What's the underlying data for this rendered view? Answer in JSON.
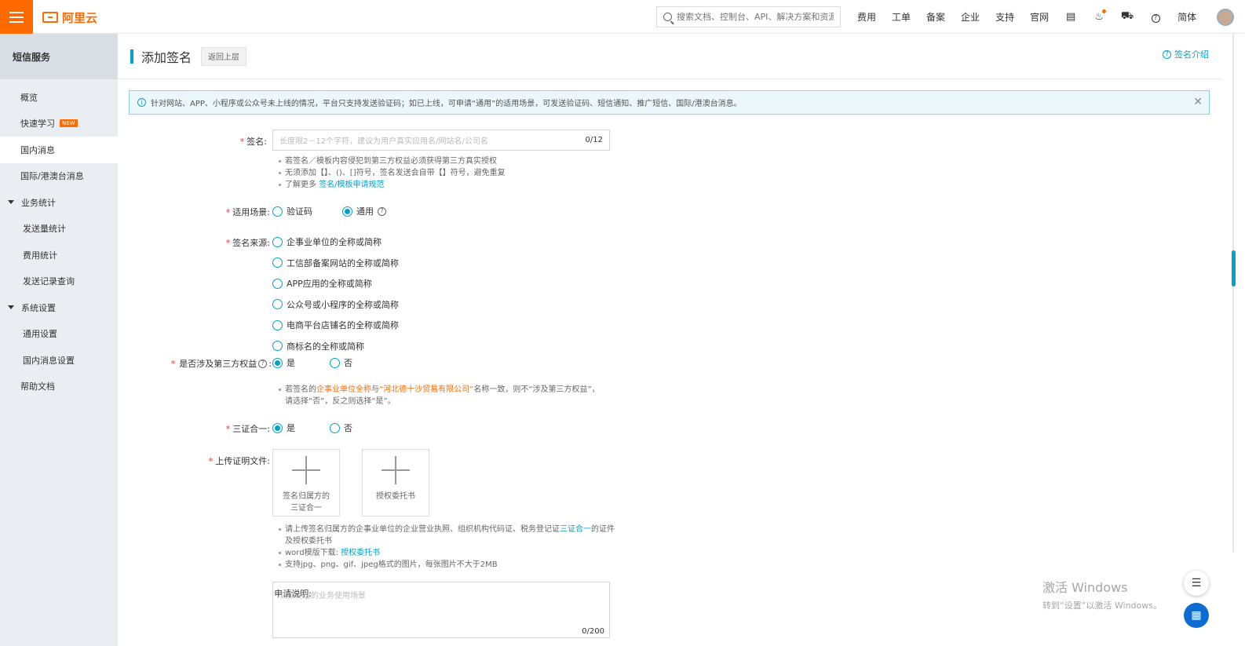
{
  "topbar": {
    "logo_text": "阿里云",
    "search_placeholder": "搜索文档、控制台、API、解决方案和资源",
    "nav": [
      "费用",
      "工单",
      "备案",
      "企业",
      "支持",
      "官网"
    ],
    "lang": "简体",
    "icons": [
      "terminal-icon",
      "bell-icon",
      "cart-icon",
      "help-icon"
    ]
  },
  "sidebar": {
    "title": "短信服务",
    "items": [
      {
        "label": "概览",
        "kind": "item"
      },
      {
        "label": "快速学习",
        "kind": "item",
        "badge": "NEW"
      },
      {
        "label": "国内消息",
        "kind": "item",
        "active": true
      },
      {
        "label": "国际/港澳台消息",
        "kind": "item"
      },
      {
        "label": "业务统计",
        "kind": "group"
      },
      {
        "label": "发送量统计",
        "kind": "sub"
      },
      {
        "label": "费用统计",
        "kind": "sub"
      },
      {
        "label": "发送记录查询",
        "kind": "sub"
      },
      {
        "label": "系统设置",
        "kind": "group"
      },
      {
        "label": "通用设置",
        "kind": "sub"
      },
      {
        "label": "国内消息设置",
        "kind": "sub"
      },
      {
        "label": "帮助文档",
        "kind": "item"
      }
    ]
  },
  "header": {
    "title": "添加签名",
    "back_label": "返回上层",
    "help_label": "签名介绍"
  },
  "notice": {
    "text": "针对网站、APP、小程序或公众号未上线的情况，平台只支持发送验证码；如已上线，可申请“通用”的适用场景，可发送验证码、短信通知、推广短信、国际/港澳台消息。"
  },
  "form": {
    "signature": {
      "label": "签名:",
      "placeholder": "长度限2－12个字符，建议为用户真实应用名/网站名/公司名",
      "counter": "0/12",
      "tips": [
        "若签名／模板内容侵犯到第三方权益必须获得第三方真实授权",
        "无须添加【】、()、[]符号，签名发送会自带【】符号，避免重复"
      ],
      "tip3_prefix": "了解更多",
      "tip3_link": "签名/模板申请规范"
    },
    "scenario": {
      "label": "适用场景:",
      "options": [
        "验证码",
        "通用"
      ],
      "selected": 1
    },
    "source": {
      "label": "签名来源:",
      "options": [
        "企事业单位的全称或简称",
        "工信部备案网站的全称或简称",
        "APP应用的全称或简称",
        "公众号或小程序的全称或简称",
        "电商平台店铺名的全称或简称",
        "商标名的全称或简称"
      ]
    },
    "third_party": {
      "label": "是否涉及第三方权益",
      "options": [
        "是",
        "否"
      ],
      "selected": 0,
      "tip_prefix": "若签名的",
      "tip_hl1": "企事业单位全称",
      "tip_mid": "与",
      "tip_hl2": "“河北德十沙贸易有限公司”",
      "tip_suffix": "名称一致，则不“涉及第三方权益”，请选择“否”，反之则选择“是”。"
    },
    "three_in_one": {
      "label": "三证合一:",
      "options": [
        "是",
        "否"
      ],
      "selected": 0
    },
    "upload": {
      "label": "上传证明文件:",
      "box1": "签名归属方的三证合一",
      "box2": "授权委托书",
      "tip1_prefix": "请上传签名归属方的企事业单位的企业营业执照、组织机构代码证、税务登记证",
      "tip1_link": "三证合一",
      "tip1_suffix": "的证件及授权委托书",
      "tip2_prefix": "word模版下载:",
      "tip2_link": "授权委托书",
      "tip3": "支持jpg、png、gif、jpeg格式的图片，每张图片不大于2MB"
    },
    "description": {
      "label": "申请说明:",
      "placeholder": "请描述您的业务使用场景",
      "counter": "0/200"
    }
  },
  "watermark": {
    "line1": "激活 Windows",
    "line2": "转到“设置”以激活 Windows。"
  },
  "colors": {
    "brand": "#ff6a00",
    "accent": "#00a2ca",
    "required": "#e4393c"
  }
}
